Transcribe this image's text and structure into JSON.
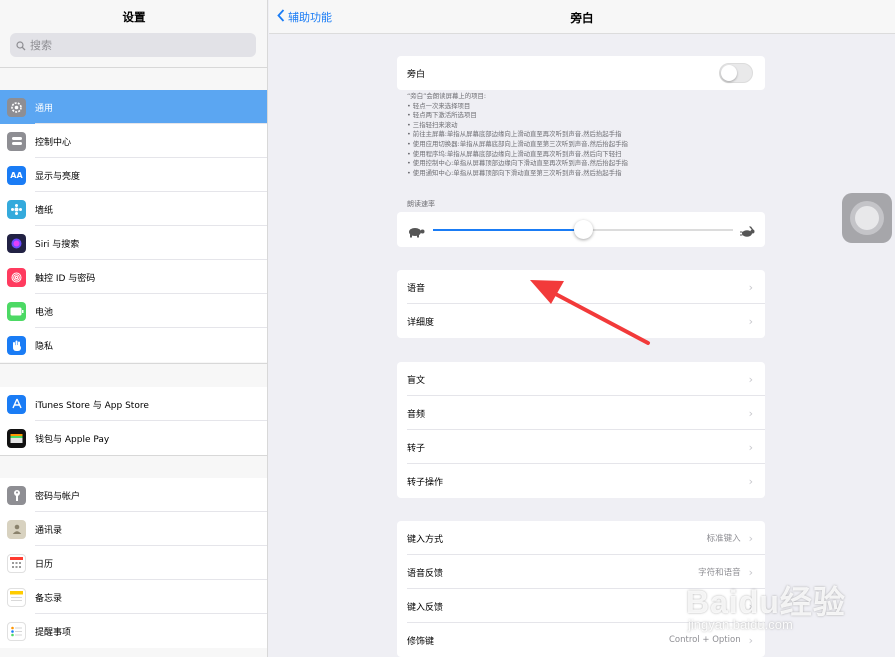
{
  "sidebar": {
    "title": "设置",
    "search_placeholder": "搜索",
    "groups": [
      [
        {
          "label": "通用",
          "icon": "gear-icon",
          "color": "#8e8e93",
          "selected": true
        },
        {
          "label": "控制中心",
          "icon": "control-center-icon",
          "color": "#8e8e93"
        },
        {
          "label": "显示与亮度",
          "icon": "display-icon",
          "color": "#1a7cf5"
        },
        {
          "label": "墙纸",
          "icon": "wallpaper-icon",
          "color": "#34aadc"
        },
        {
          "label": "Siri 与搜索",
          "icon": "siri-icon",
          "color": "#222244"
        },
        {
          "label": "触控 ID 与密码",
          "icon": "fingerprint-icon",
          "color": "#ff3b5f"
        },
        {
          "label": "电池",
          "icon": "battery-icon",
          "color": "#4cd964"
        },
        {
          "label": "隐私",
          "icon": "hand-icon",
          "color": "#1a7cf5"
        }
      ],
      [
        {
          "label": "iTunes Store 与 App Store",
          "icon": "app-store-icon",
          "color": "#1a7cf5"
        },
        {
          "label": "钱包与 Apple Pay",
          "icon": "wallet-icon",
          "color": "#111111"
        }
      ],
      [
        {
          "label": "密码与帐户",
          "icon": "key-icon",
          "color": "#8e8e93"
        },
        {
          "label": "通讯录",
          "icon": "contacts-icon",
          "color": "#b0a890"
        },
        {
          "label": "日历",
          "icon": "calendar-icon",
          "color": "#ffffff"
        },
        {
          "label": "备忘录",
          "icon": "notes-icon",
          "color": "#ffffff"
        },
        {
          "label": "提醒事项",
          "icon": "reminders-icon",
          "color": "#ffffff"
        }
      ]
    ]
  },
  "nav": {
    "back_label": "辅助功能",
    "title": "旁白"
  },
  "voiceover": {
    "toggle_label": "旁白",
    "toggle_on": false,
    "description": [
      "“旁白”会朗读屏幕上的项目:",
      "• 轻点一次来选择项目",
      "• 轻点两下激活所选项目",
      "• 三指轻扫来滚动",
      "• 前往主屏幕:单指从屏幕底部边缘向上滑动直至再次听到声音,然后抬起手指",
      "• 使用应用切换器:单指从屏幕底部向上滑动直至第三次听到声音,然后抬起手指",
      "• 使用程序坞:单指从屏幕底部边缘向上滑动直至再次听到声音,然后向下轻扫",
      "• 使用控制中心:单指从屏幕顶部边缘向下滑动直至再次听到声音,然后抬起手指",
      "• 使用通知中心:单指从屏幕顶部向下滑动直至第三次听到声音,然后抬起手指"
    ]
  },
  "speaking_rate": {
    "label": "朗读速率",
    "value": 0.5
  },
  "group1": [
    {
      "label": "语音"
    },
    {
      "label": "详细度"
    }
  ],
  "group2": [
    {
      "label": "盲文"
    },
    {
      "label": "音频"
    },
    {
      "label": "转子"
    },
    {
      "label": "转子操作"
    }
  ],
  "group3": [
    {
      "label": "键入方式",
      "value": "标准键入"
    },
    {
      "label": "语音反馈",
      "value": "字符和语音"
    },
    {
      "label": "键入反馈",
      "value": ""
    },
    {
      "label": "修饰键",
      "value": "Control + Option"
    }
  ],
  "watermark": {
    "brand": "Baidu经验",
    "url": "jingyan.baidu.com"
  },
  "colors": {
    "accent": "#1a7cf5",
    "selection": "#5ba6f2",
    "annotation_arrow": "#f23a3a"
  }
}
